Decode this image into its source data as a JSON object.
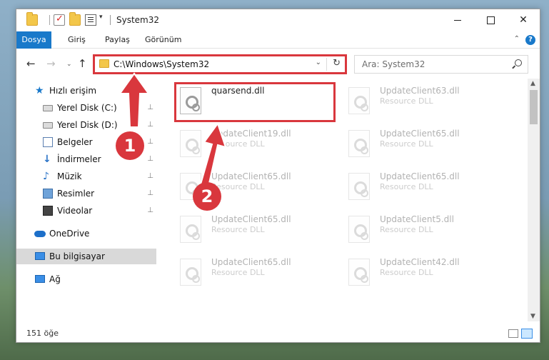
{
  "window": {
    "title": "System32",
    "controls": {
      "minimize": "",
      "maximize": "",
      "close": "✕"
    }
  },
  "quick_access_toolbar": {
    "dropdown": "▾"
  },
  "ribbon": {
    "tabs": [
      {
        "label": "Dosya",
        "active": true
      },
      {
        "label": "Giriş"
      },
      {
        "label": "Paylaş"
      },
      {
        "label": "Görünüm"
      }
    ],
    "collapse_icon": "⌃",
    "help_icon": "?"
  },
  "navigation": {
    "back": "←",
    "forward": "→",
    "recent": "⌄",
    "up": "↑"
  },
  "address_bar": {
    "path": "C:\\Windows\\System32",
    "dropdown": "⌄",
    "refresh": "↻"
  },
  "search": {
    "placeholder": "Ara: System32"
  },
  "sidebar": {
    "items": [
      {
        "label": "Hızlı erişim",
        "icon": "star-icon"
      },
      {
        "label": "Yerel Disk (C:)",
        "icon": "drive-icon",
        "pinned": true
      },
      {
        "label": "Yerel Disk (D:)",
        "icon": "drive-icon",
        "pinned": true
      },
      {
        "label": "Belgeler",
        "icon": "documents-icon",
        "pinned": true
      },
      {
        "label": "İndirmeler",
        "icon": "download-icon",
        "pinned": true
      },
      {
        "label": "Müzik",
        "icon": "music-icon",
        "pinned": true
      },
      {
        "label": "Resimler",
        "icon": "pictures-icon",
        "pinned": true
      },
      {
        "label": "Videolar",
        "icon": "videos-icon",
        "pinned": true
      },
      {
        "label": "OneDrive",
        "icon": "cloud-icon"
      },
      {
        "label": "Bu bilgisayar",
        "icon": "computer-icon",
        "selected": true
      },
      {
        "label": "Ağ",
        "icon": "network-icon"
      }
    ],
    "pin_glyph": "📌"
  },
  "files": [
    {
      "name": "quarsend.dll",
      "type": "",
      "highlighted": true
    },
    {
      "name": "UpdateClient63.dll",
      "type": "Resource DLL"
    },
    {
      "name": "UpdateClient19.dll",
      "type": "Resource DLL"
    },
    {
      "name": "UpdateClient65.dll",
      "type": "Resource DLL"
    },
    {
      "name": "UpdateClient65.dll",
      "type": "Resource DLL"
    },
    {
      "name": "UpdateClient65.dll",
      "type": "Resource DLL"
    },
    {
      "name": "UpdateClient65.dll",
      "type": "Resource DLL"
    },
    {
      "name": "UpdateClient5.dll",
      "type": "Resource DLL"
    },
    {
      "name": "UpdateClient65.dll",
      "type": "Resource DLL"
    },
    {
      "name": "UpdateClient42.dll",
      "type": "Resource DLL"
    }
  ],
  "status_bar": {
    "item_count": "151 öğe"
  },
  "annotations": {
    "step1": "1",
    "step2": "2"
  },
  "colors": {
    "accent": "#1979ca",
    "highlight": "#d9373d",
    "folder": "#f3c74a"
  }
}
